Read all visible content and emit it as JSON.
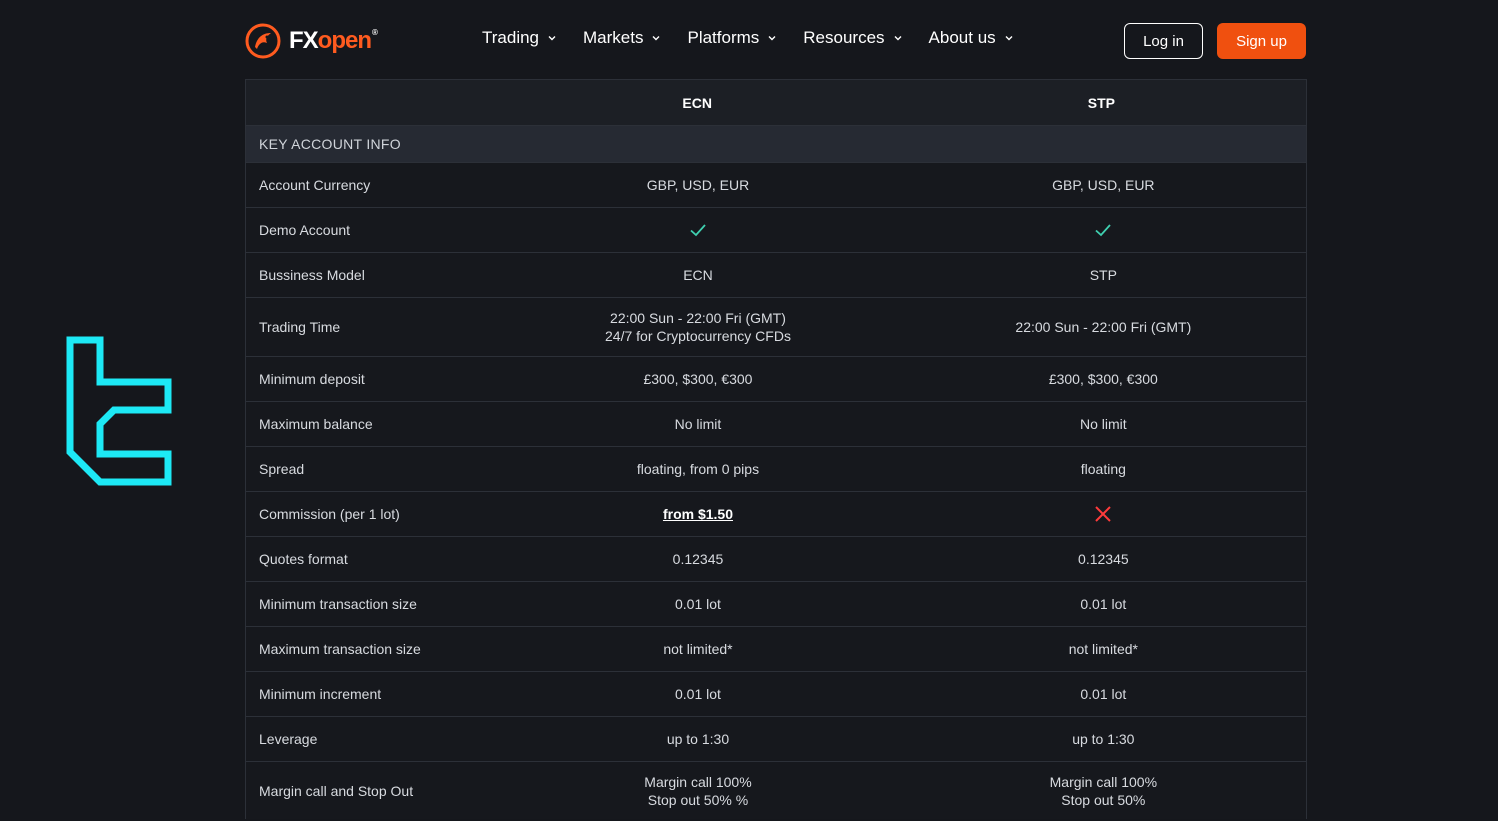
{
  "header": {
    "brand": {
      "fx": "FX",
      "open": "open",
      "reg": "®"
    },
    "nav": [
      {
        "label": "Trading"
      },
      {
        "label": "Markets"
      },
      {
        "label": "Platforms"
      },
      {
        "label": "Resources"
      },
      {
        "label": "About us"
      }
    ],
    "login_label": "Log in",
    "signup_label": "Sign up"
  },
  "table": {
    "columns": [
      "",
      "ECN",
      "STP"
    ],
    "section_title": "KEY ACCOUNT INFO",
    "rows": [
      {
        "label": "Account Currency",
        "ecn": "GBP, USD, EUR",
        "stp": "GBP, USD, EUR"
      },
      {
        "label": "Demo Account",
        "ecn_icon": "check-icon",
        "stp_icon": "check-icon"
      },
      {
        "label": "Bussiness Model",
        "ecn": "ECN",
        "stp": "STP"
      },
      {
        "label": "Trading Time",
        "ecn": "22:00 Sun - 22:00 Fri (GMT)",
        "ecn2": "24/7 for Cryptocurrency CFDs",
        "stp": "22:00 Sun - 22:00 Fri (GMT)"
      },
      {
        "label": "Minimum deposit",
        "ecn": "£300, $300, €300",
        "stp": "£300, $300, €300"
      },
      {
        "label": "Maximum balance",
        "ecn": "No limit",
        "stp": "No limit"
      },
      {
        "label": "Spread",
        "ecn": "floating, from 0 pips",
        "stp": "floating"
      },
      {
        "label": "Commission (per 1 lot)",
        "ecn": "from $1.50",
        "stp_icon": "cross-icon"
      },
      {
        "label": "Quotes format",
        "ecn": "0.12345",
        "stp": "0.12345"
      },
      {
        "label": "Minimum transaction size",
        "ecn": "0.01 lot",
        "stp": "0.01 lot"
      },
      {
        "label": "Maximum transaction size",
        "ecn": "not limited*",
        "stp": "not limited*"
      },
      {
        "label": "Minimum increment",
        "ecn": "0.01 lot",
        "stp": "0.01 lot"
      },
      {
        "label": "Leverage",
        "ecn": "up to 1:30",
        "stp": "up to 1:30"
      },
      {
        "label": "Margin call and Stop Out",
        "ecn": "Margin call 100%",
        "ecn2": "Stop out 50% %",
        "stp": "Margin call 100%",
        "stp2": "Stop out 50%"
      }
    ]
  },
  "colors": {
    "accent": "#f0500f",
    "check": "#3fd0b0",
    "cross": "#ff3b3b",
    "side_logo": "#1de9f5"
  }
}
